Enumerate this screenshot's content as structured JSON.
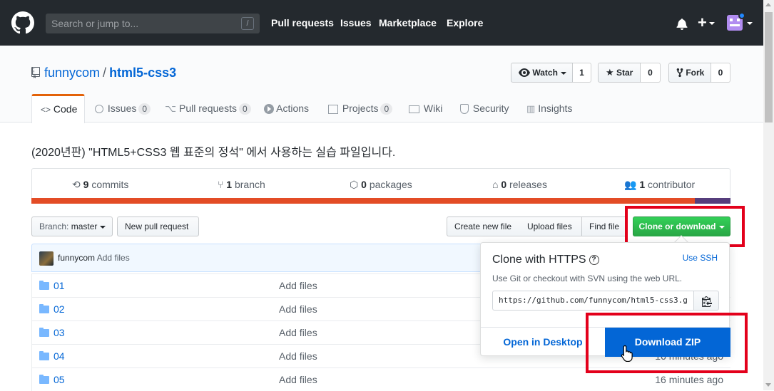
{
  "header": {
    "search_placeholder": "Search or jump to...",
    "search_shortcut": "/",
    "nav": [
      "Pull requests",
      "Issues",
      "Marketplace",
      "Explore"
    ],
    "plus_label": "+"
  },
  "repo": {
    "owner": "funnycom",
    "separator": "/",
    "name": "html5-css3",
    "watch_label": "Watch",
    "watch_count": "1",
    "star_label": "Star",
    "star_count": "0",
    "fork_label": "Fork",
    "fork_count": "0"
  },
  "tabs": [
    {
      "label": "Code",
      "icon": "code-icon",
      "counter": ""
    },
    {
      "label": "Issues",
      "icon": "issue-icon",
      "counter": "0"
    },
    {
      "label": "Pull requests",
      "icon": "pull-request-icon",
      "counter": "0"
    },
    {
      "label": "Actions",
      "icon": "play-icon",
      "counter": ""
    },
    {
      "label": "Projects",
      "icon": "project-icon",
      "counter": "0"
    },
    {
      "label": "Wiki",
      "icon": "book-icon",
      "counter": ""
    },
    {
      "label": "Security",
      "icon": "shield-icon",
      "counter": ""
    },
    {
      "label": "Insights",
      "icon": "graph-icon",
      "counter": ""
    }
  ],
  "description": "(2020년판) \"HTML5+CSS3 웹 표준의 정석\" 에서 사용하는 실습 파일입니다.",
  "summary": {
    "commits_count": "9",
    "commits_label": "commits",
    "branch_count": "1",
    "branch_label": "branch",
    "packages_count": "0",
    "packages_label": "packages",
    "releases_count": "0",
    "releases_label": "releases",
    "contributor_count": "1",
    "contributor_label": "contributor"
  },
  "languages": {
    "html_color": "#e34c26",
    "css_color": "#563d7c"
  },
  "file_nav": {
    "branch_prefix": "Branch:",
    "branch_name": "master",
    "new_pull_request": "New pull request",
    "create_new_file": "Create new file",
    "upload_files": "Upload files",
    "find_file": "Find file",
    "clone_or_download": "Clone or download"
  },
  "commit": {
    "author": "funnycom",
    "message": "Add files"
  },
  "files": [
    {
      "name": "01",
      "message": "Add files",
      "age": ""
    },
    {
      "name": "02",
      "message": "Add files",
      "age": ""
    },
    {
      "name": "03",
      "message": "Add files",
      "age": ""
    },
    {
      "name": "04",
      "message": "Add files",
      "age": "16 minutes ago"
    },
    {
      "name": "05",
      "message": "Add files",
      "age": "16 minutes ago"
    }
  ],
  "clone": {
    "title": "Clone with HTTPS",
    "help": "?",
    "use_ssh": "Use SSH",
    "subtitle": "Use Git or checkout with SVN using the web URL.",
    "url": "https://github.com/funnycom/html5-css3.g",
    "open_desktop": "Open in Desktop",
    "download_zip": "Download ZIP"
  },
  "colors": {
    "header_bg": "#24292e",
    "link": "#0366d6",
    "green": "#28a745",
    "highlight_red": "#e3001b",
    "tab_accent": "#e36209"
  }
}
